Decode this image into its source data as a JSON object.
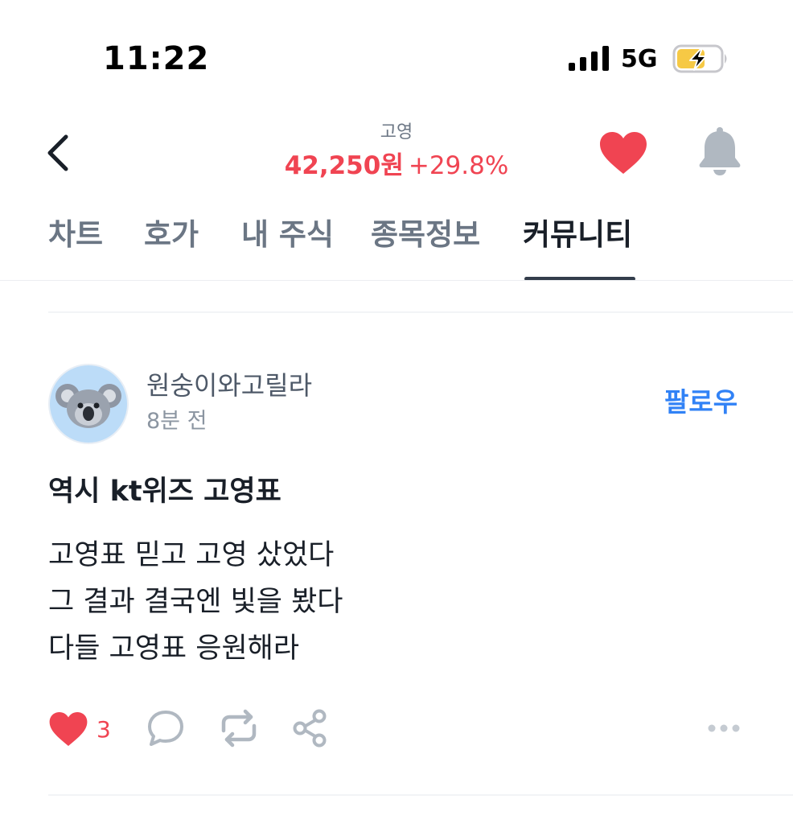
{
  "status_bar": {
    "time": "11:22",
    "network": "5G",
    "icons": [
      "signal-bars-icon",
      "battery-charging-icon"
    ]
  },
  "header": {
    "stock_name": "고영",
    "price": "42,250원",
    "change": "+29.8%",
    "price_color": "#f04452",
    "icons": [
      "chevron-left-icon",
      "heart-icon",
      "bell-icon"
    ]
  },
  "tabs": [
    {
      "label": "차트",
      "active": false
    },
    {
      "label": "호가",
      "active": false
    },
    {
      "label": "내 주식",
      "active": false
    },
    {
      "label": "종목정보",
      "active": false
    },
    {
      "label": "커뮤니티",
      "active": true
    }
  ],
  "post": {
    "author": "원숭이와고릴라",
    "time": "8분 전",
    "avatar_icon": "koala-icon",
    "follow_label": "팔로우",
    "title": "역시 kt위즈 고영표",
    "body": [
      "고영표 믿고 고영 샀었다",
      "그 결과 결국엔 빛을 봤다",
      "다들 고영표 응원해라"
    ],
    "like_count": "3",
    "action_icons": [
      "heart-icon",
      "comment-icon",
      "repost-icon",
      "share-icon",
      "more-icon"
    ]
  },
  "colors": {
    "accent_red": "#f04452",
    "accent_blue": "#3182f6",
    "text_primary": "#191f28",
    "text_secondary": "#6b7684",
    "icon_gray": "#b0b8c1"
  }
}
